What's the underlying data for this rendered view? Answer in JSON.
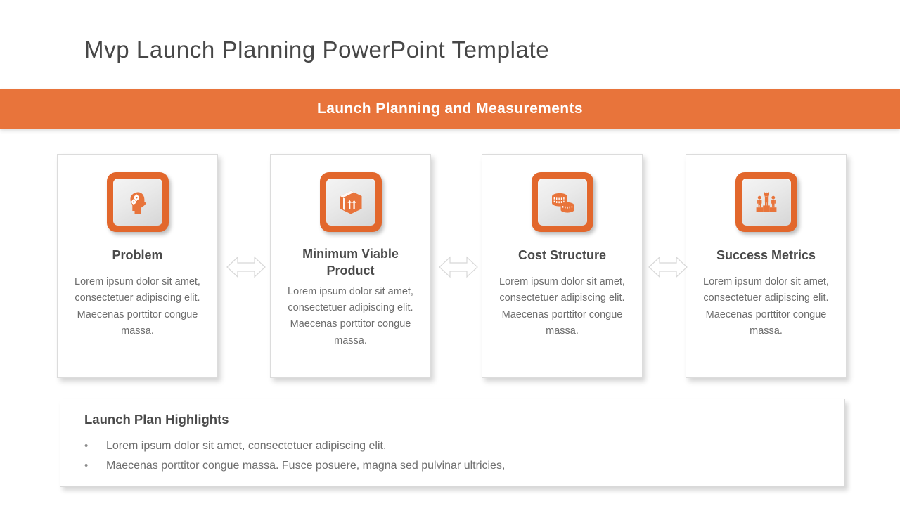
{
  "page": {
    "title": "Mvp Launch Planning PowerPoint Template"
  },
  "banner": {
    "title": "Launch Planning and Measurements",
    "color": "#e8743b"
  },
  "cards": [
    {
      "icon": "head-with-gears-icon",
      "title": "Problem",
      "body": "Lorem ipsum dolor sit amet, consectetuer adipiscing elit. Maecenas porttitor congue massa."
    },
    {
      "icon": "package-box-icon",
      "title": "Minimum Viable Product",
      "body": "Lorem ipsum dolor sit amet, consectetuer adipiscing elit. Maecenas porttitor congue massa."
    },
    {
      "icon": "stacked-coins-icon",
      "title": "Cost Structure",
      "body": "Lorem ipsum dolor sit amet, consectetuer adipiscing elit. Maecenas porttitor congue massa."
    },
    {
      "icon": "podium-winners-icon",
      "title": "Success Metrics",
      "body": "Lorem ipsum dolor sit amet, consectetuer adipiscing elit. Maecenas porttitor congue massa."
    }
  ],
  "connectors": [
    {
      "icon": "double-arrow-icon"
    },
    {
      "icon": "double-arrow-icon"
    },
    {
      "icon": "double-arrow-icon"
    }
  ],
  "highlights": {
    "title": "Launch Plan Highlights",
    "bullet_marker": "•",
    "items": [
      "Lorem ipsum dolor sit amet, consectetuer  adipiscing elit.",
      "Maecenas porttitor congue massa. Fusce posuere, magna sed pulvinar ultricies,"
    ]
  }
}
